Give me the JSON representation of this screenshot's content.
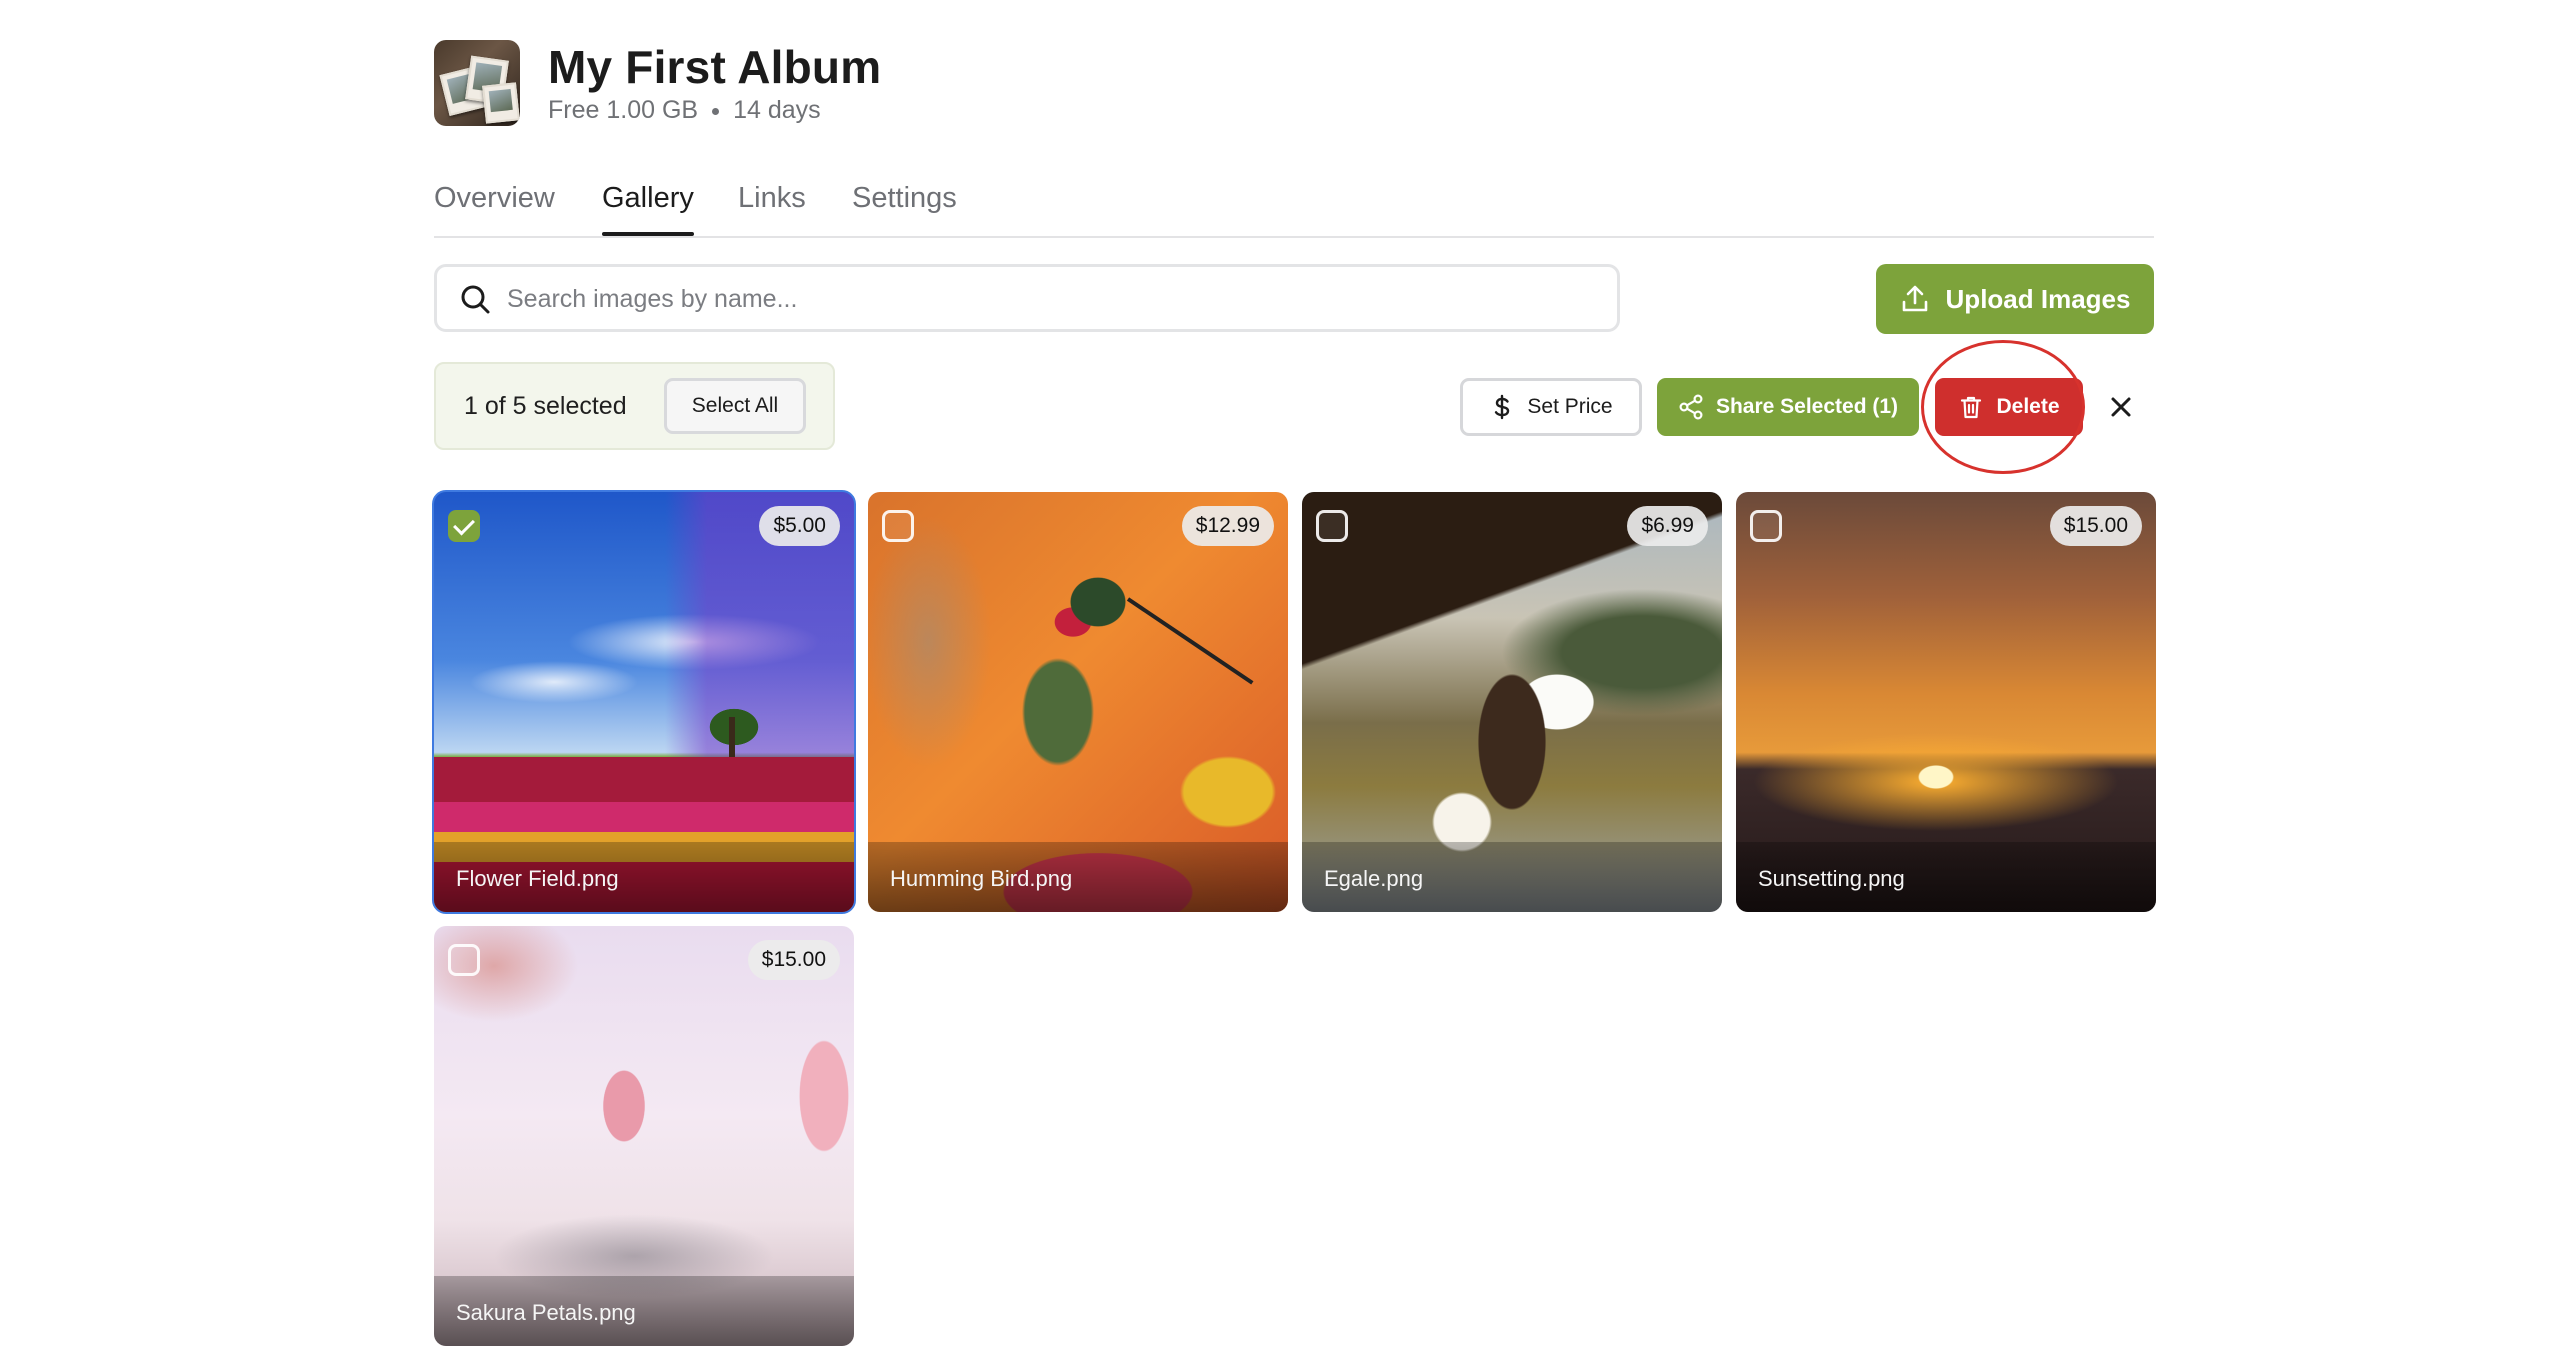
{
  "album": {
    "title": "My First Album",
    "plan": "Free 1.00 GB",
    "duration": "14 days"
  },
  "tabs": [
    {
      "label": "Overview",
      "active": false
    },
    {
      "label": "Gallery",
      "active": true
    },
    {
      "label": "Links",
      "active": false
    },
    {
      "label": "Settings",
      "active": false
    }
  ],
  "search": {
    "placeholder": "Search images by name...",
    "value": ""
  },
  "upload": {
    "label": "Upload Images"
  },
  "selection": {
    "summary": "1 of 5 selected",
    "select_all_label": "Select All"
  },
  "actions": {
    "set_price": "Set Price",
    "share": "Share Selected (1)",
    "delete": "Delete"
  },
  "images": [
    {
      "name": "Flower Field.png",
      "price": "$5.00",
      "selected": true
    },
    {
      "name": "Humming Bird.png",
      "price": "$12.99",
      "selected": false
    },
    {
      "name": "Egale.png",
      "price": "$6.99",
      "selected": false
    },
    {
      "name": "Sunsetting.png",
      "price": "$15.00",
      "selected": false
    },
    {
      "name": "Sakura Petals.png",
      "price": "$15.00",
      "selected": false
    }
  ],
  "colors": {
    "accent_green": "#7da33b",
    "danger_red": "#cf2f2d",
    "selection_blue": "#3f7ae0"
  },
  "icons": [
    "album-cover",
    "search-icon",
    "upload-icon",
    "dollar-icon",
    "share-icon",
    "trash-icon",
    "close-icon",
    "checkbox-icon"
  ]
}
